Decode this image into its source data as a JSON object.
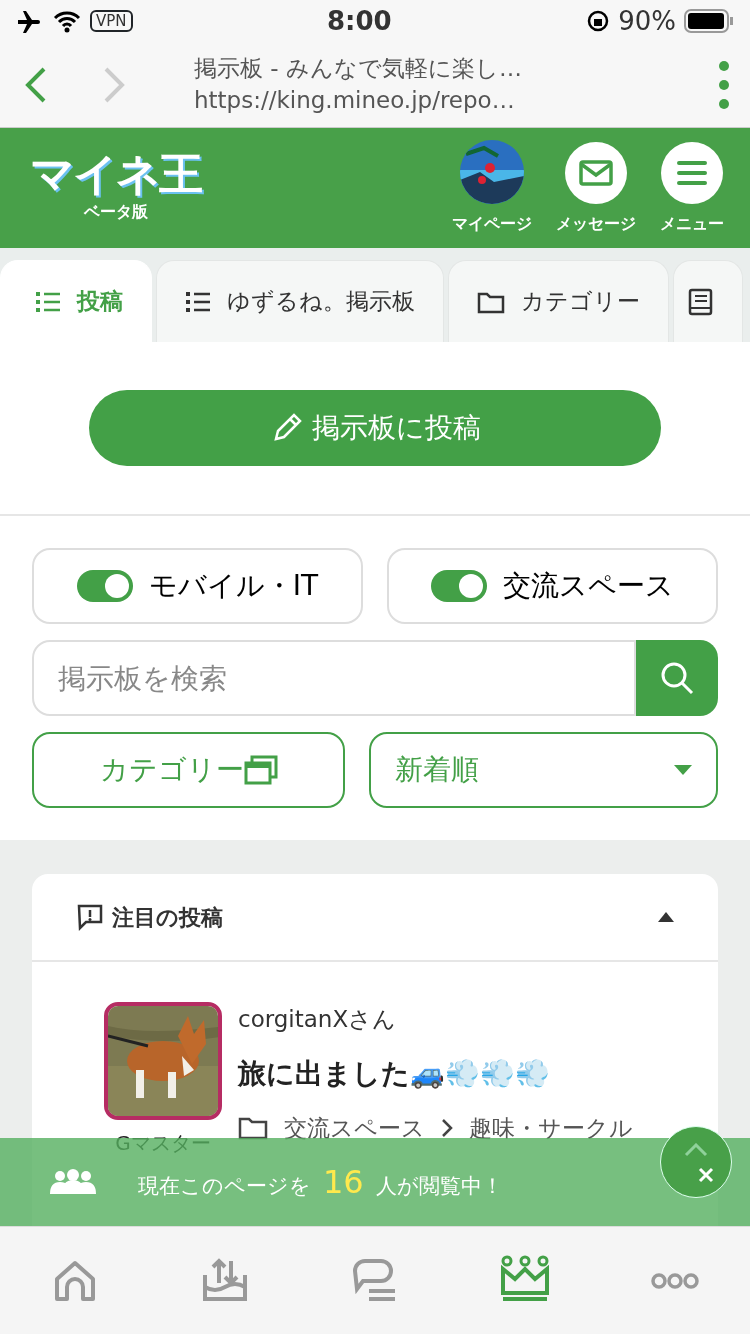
{
  "status_bar": {
    "vpn": "VPN",
    "time": "8:00",
    "battery": "90%"
  },
  "browser": {
    "title": "掲示板 - みんなで気軽に楽し…",
    "url": "https://king.mineo.jp/repo…"
  },
  "header": {
    "logo": "マイネ王",
    "logo_sub": "ベータ版",
    "actions": [
      {
        "kind": "avatar",
        "label": "マイページ"
      },
      {
        "kind": "mail",
        "label": "メッセージ"
      },
      {
        "kind": "menu",
        "label": "メニュー"
      }
    ]
  },
  "tabs": [
    {
      "kind": "list",
      "label": "投稿",
      "selected": true
    },
    {
      "kind": "list",
      "label": "ゆずるね。掲示板",
      "selected": false
    },
    {
      "kind": "folder",
      "label": "カテゴリー",
      "selected": false
    },
    {
      "kind": "book",
      "selected": false
    }
  ],
  "post_button": "掲示板に投稿",
  "filters": [
    {
      "label": "モバイル・IT",
      "on": true
    },
    {
      "label": "交流スペース",
      "on": true
    }
  ],
  "search": {
    "placeholder": "掲示板を検索"
  },
  "category_button": "カテゴリー",
  "sort": {
    "value": "新着順"
  },
  "featured": {
    "title": "注目の投稿",
    "expanded": true,
    "posts": [
      {
        "user": "corgitanXさん",
        "rank": "Gマスター",
        "title": "旅に出ました🚙💨💨💨",
        "path": [
          "交流スペース",
          "趣味・サークル"
        ]
      }
    ]
  },
  "viewer_banner": {
    "before": "現在このページを",
    "count": "16",
    "after": "人が閲覧中！"
  },
  "bottom_nav": [
    {
      "kind": "home",
      "selected": false
    },
    {
      "kind": "upload",
      "selected": false
    },
    {
      "kind": "chat",
      "selected": false
    },
    {
      "kind": "crown",
      "selected": true
    },
    {
      "kind": "more",
      "selected": false
    }
  ]
}
